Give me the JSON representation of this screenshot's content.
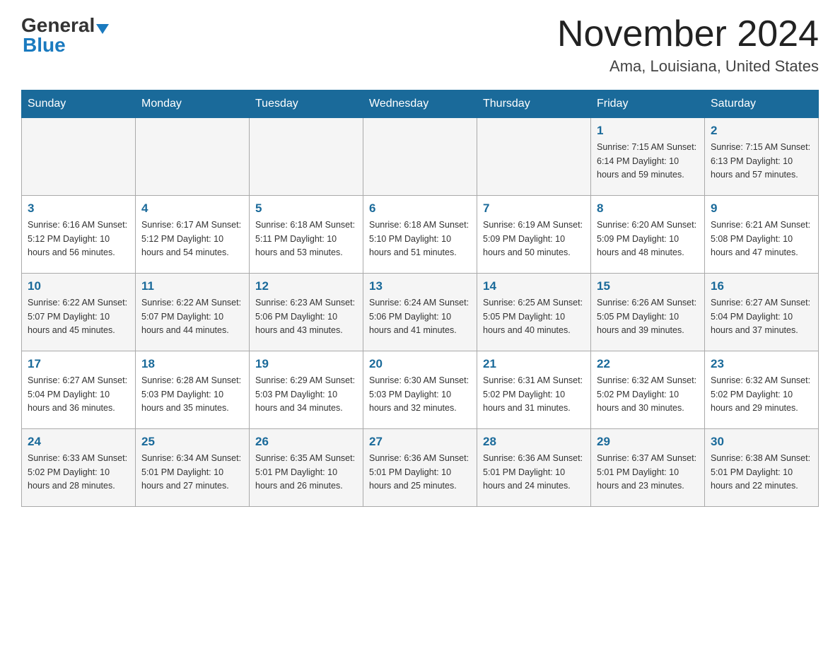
{
  "header": {
    "logo_general": "General",
    "logo_blue": "Blue",
    "month_title": "November 2024",
    "location": "Ama, Louisiana, United States"
  },
  "weekdays": [
    "Sunday",
    "Monday",
    "Tuesday",
    "Wednesday",
    "Thursday",
    "Friday",
    "Saturday"
  ],
  "weeks": [
    [
      {
        "day": "",
        "info": ""
      },
      {
        "day": "",
        "info": ""
      },
      {
        "day": "",
        "info": ""
      },
      {
        "day": "",
        "info": ""
      },
      {
        "day": "",
        "info": ""
      },
      {
        "day": "1",
        "info": "Sunrise: 7:15 AM\nSunset: 6:14 PM\nDaylight: 10 hours\nand 59 minutes."
      },
      {
        "day": "2",
        "info": "Sunrise: 7:15 AM\nSunset: 6:13 PM\nDaylight: 10 hours\nand 57 minutes."
      }
    ],
    [
      {
        "day": "3",
        "info": "Sunrise: 6:16 AM\nSunset: 5:12 PM\nDaylight: 10 hours\nand 56 minutes."
      },
      {
        "day": "4",
        "info": "Sunrise: 6:17 AM\nSunset: 5:12 PM\nDaylight: 10 hours\nand 54 minutes."
      },
      {
        "day": "5",
        "info": "Sunrise: 6:18 AM\nSunset: 5:11 PM\nDaylight: 10 hours\nand 53 minutes."
      },
      {
        "day": "6",
        "info": "Sunrise: 6:18 AM\nSunset: 5:10 PM\nDaylight: 10 hours\nand 51 minutes."
      },
      {
        "day": "7",
        "info": "Sunrise: 6:19 AM\nSunset: 5:09 PM\nDaylight: 10 hours\nand 50 minutes."
      },
      {
        "day": "8",
        "info": "Sunrise: 6:20 AM\nSunset: 5:09 PM\nDaylight: 10 hours\nand 48 minutes."
      },
      {
        "day": "9",
        "info": "Sunrise: 6:21 AM\nSunset: 5:08 PM\nDaylight: 10 hours\nand 47 minutes."
      }
    ],
    [
      {
        "day": "10",
        "info": "Sunrise: 6:22 AM\nSunset: 5:07 PM\nDaylight: 10 hours\nand 45 minutes."
      },
      {
        "day": "11",
        "info": "Sunrise: 6:22 AM\nSunset: 5:07 PM\nDaylight: 10 hours\nand 44 minutes."
      },
      {
        "day": "12",
        "info": "Sunrise: 6:23 AM\nSunset: 5:06 PM\nDaylight: 10 hours\nand 43 minutes."
      },
      {
        "day": "13",
        "info": "Sunrise: 6:24 AM\nSunset: 5:06 PM\nDaylight: 10 hours\nand 41 minutes."
      },
      {
        "day": "14",
        "info": "Sunrise: 6:25 AM\nSunset: 5:05 PM\nDaylight: 10 hours\nand 40 minutes."
      },
      {
        "day": "15",
        "info": "Sunrise: 6:26 AM\nSunset: 5:05 PM\nDaylight: 10 hours\nand 39 minutes."
      },
      {
        "day": "16",
        "info": "Sunrise: 6:27 AM\nSunset: 5:04 PM\nDaylight: 10 hours\nand 37 minutes."
      }
    ],
    [
      {
        "day": "17",
        "info": "Sunrise: 6:27 AM\nSunset: 5:04 PM\nDaylight: 10 hours\nand 36 minutes."
      },
      {
        "day": "18",
        "info": "Sunrise: 6:28 AM\nSunset: 5:03 PM\nDaylight: 10 hours\nand 35 minutes."
      },
      {
        "day": "19",
        "info": "Sunrise: 6:29 AM\nSunset: 5:03 PM\nDaylight: 10 hours\nand 34 minutes."
      },
      {
        "day": "20",
        "info": "Sunrise: 6:30 AM\nSunset: 5:03 PM\nDaylight: 10 hours\nand 32 minutes."
      },
      {
        "day": "21",
        "info": "Sunrise: 6:31 AM\nSunset: 5:02 PM\nDaylight: 10 hours\nand 31 minutes."
      },
      {
        "day": "22",
        "info": "Sunrise: 6:32 AM\nSunset: 5:02 PM\nDaylight: 10 hours\nand 30 minutes."
      },
      {
        "day": "23",
        "info": "Sunrise: 6:32 AM\nSunset: 5:02 PM\nDaylight: 10 hours\nand 29 minutes."
      }
    ],
    [
      {
        "day": "24",
        "info": "Sunrise: 6:33 AM\nSunset: 5:02 PM\nDaylight: 10 hours\nand 28 minutes."
      },
      {
        "day": "25",
        "info": "Sunrise: 6:34 AM\nSunset: 5:01 PM\nDaylight: 10 hours\nand 27 minutes."
      },
      {
        "day": "26",
        "info": "Sunrise: 6:35 AM\nSunset: 5:01 PM\nDaylight: 10 hours\nand 26 minutes."
      },
      {
        "day": "27",
        "info": "Sunrise: 6:36 AM\nSunset: 5:01 PM\nDaylight: 10 hours\nand 25 minutes."
      },
      {
        "day": "28",
        "info": "Sunrise: 6:36 AM\nSunset: 5:01 PM\nDaylight: 10 hours\nand 24 minutes."
      },
      {
        "day": "29",
        "info": "Sunrise: 6:37 AM\nSunset: 5:01 PM\nDaylight: 10 hours\nand 23 minutes."
      },
      {
        "day": "30",
        "info": "Sunrise: 6:38 AM\nSunset: 5:01 PM\nDaylight: 10 hours\nand 22 minutes."
      }
    ]
  ]
}
